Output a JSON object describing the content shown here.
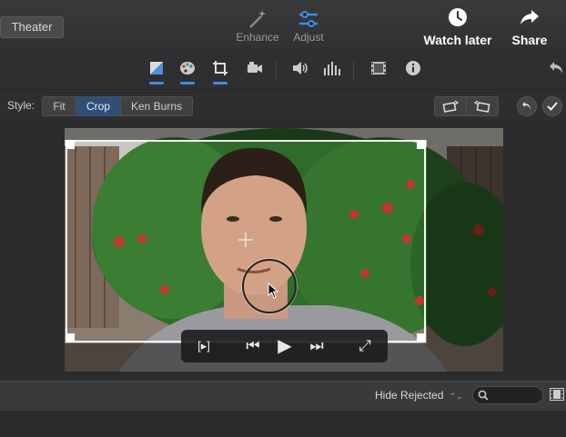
{
  "window": {
    "theater_label": "Theater",
    "enhance_label": "Enhance",
    "adjust_label": "Adjust",
    "watch_later_label": "Watch later",
    "share_label": "Share"
  },
  "style_row": {
    "style_label": "Style:",
    "options": [
      "Fit",
      "Crop",
      "Ken Burns"
    ],
    "selected": "Crop"
  },
  "tools": {
    "color_balance_icon": "color-balance-icon",
    "color_correction_icon": "palette-icon",
    "crop_icon": "crop-icon",
    "stabilization_icon": "camera-icon",
    "volume_icon": "speaker-icon",
    "equalizer_icon": "equalizer-icon",
    "filter_icon": "film-filter-icon",
    "info_icon": "info-icon",
    "revert_icon": "undo-arrow-icon"
  },
  "playback": {
    "trim_label": "[▸]",
    "rewind": "⏮",
    "play": "▶",
    "forward": "⏭",
    "fullscreen": "⤢"
  },
  "bottom": {
    "filter_label": "Hide Rejected",
    "filter_arrow": "⌃⌄",
    "search_placeholder": ""
  },
  "colors": {
    "accent": "#3a8ee6",
    "selected_segment": "#2f4f78"
  }
}
